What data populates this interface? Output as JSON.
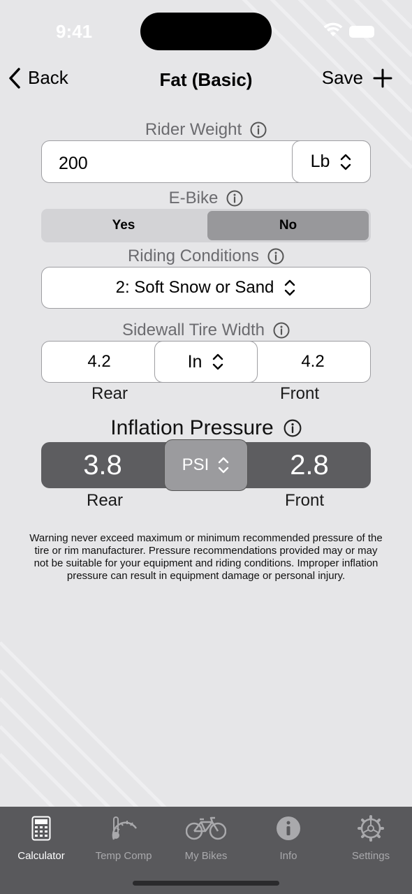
{
  "status": {
    "time": "9:41"
  },
  "nav": {
    "back_label": "Back",
    "title": "Fat (Basic)",
    "save_label": "Save"
  },
  "rider_weight": {
    "label": "Rider Weight",
    "value": "200",
    "unit": "Lb"
  },
  "ebike": {
    "label": "E-Bike",
    "options": [
      "Yes",
      "No"
    ],
    "selected": "No"
  },
  "riding_conditions": {
    "label": "Riding Conditions",
    "value": "2: Soft Snow or Sand"
  },
  "sidewall": {
    "label": "Sidewall Tire Width",
    "rear": "4.2",
    "unit": "In",
    "front": "4.2",
    "rear_label": "Rear",
    "front_label": "Front"
  },
  "inflation": {
    "label": "Inflation Pressure",
    "rear": "3.8",
    "unit": "PSI",
    "front": "2.8",
    "rear_label": "Rear",
    "front_label": "Front"
  },
  "warning": "Warning never exceed maximum or minimum recommended pressure of the tire or rim manufacturer. Pressure recommendations provided may or may not be suitable for your equipment and riding conditions. Improper inflation pressure can result in equipment damage or personal injury.",
  "tabs": [
    {
      "label": "Calculator",
      "icon": "calculator-icon",
      "active": true
    },
    {
      "label": "Temp Comp",
      "icon": "thermometer-gauge-icon",
      "active": false
    },
    {
      "label": "My Bikes",
      "icon": "bicycle-icon",
      "active": false
    },
    {
      "label": "Info",
      "icon": "info-icon",
      "active": false
    },
    {
      "label": "Settings",
      "icon": "gear-icon",
      "active": false
    }
  ],
  "colors": {
    "background": "#e6e6e8",
    "tabbar": "#59595c",
    "pressure_bar": "#5d5d60",
    "psi_button": "#9b9b9e",
    "segment_selected": "#98989b"
  }
}
